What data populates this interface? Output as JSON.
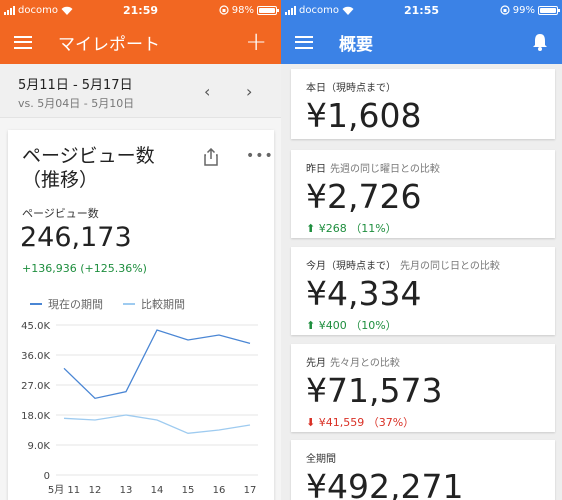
{
  "left": {
    "status": {
      "carrier": "docomo",
      "time": "21:59",
      "battery": "98%",
      "battery_level": 0.98
    },
    "appbar": {
      "title": "マイレポート",
      "add_label": "+"
    },
    "date_range": {
      "range": "5月11日 - 5月17日",
      "compare": "vs. 5月04日 - 5月10日",
      "prev": "‹",
      "next": "›"
    },
    "card": {
      "title": "ページビュー数（推移）",
      "more": "•••",
      "metric_label": "ページビュー数",
      "metric_value": "246,173",
      "metric_delta": "+136,936 (+125.36%)",
      "legend": [
        "現在の期間",
        "比較期間"
      ]
    },
    "chart_data": {
      "type": "line",
      "x": [
        "5月 11",
        "12",
        "13",
        "14",
        "15",
        "16",
        "17"
      ],
      "yticks": [
        "45.0K",
        "36.0K",
        "27.0K",
        "18.0K",
        "9.0K",
        "0"
      ],
      "ylim": [
        0,
        45000
      ],
      "series": [
        {
          "name": "現在の期間",
          "color": "#4a86d4",
          "values": [
            32000,
            23000,
            25000,
            43500,
            40500,
            42000,
            39500
          ]
        },
        {
          "name": "比較期間",
          "color": "#9ecbf0",
          "values": [
            17000,
            16500,
            18000,
            16500,
            12500,
            13500,
            15000
          ]
        }
      ]
    },
    "colors": {
      "accent": "#f26722"
    }
  },
  "right": {
    "status": {
      "carrier": "docomo",
      "time": "21:55",
      "battery": "99%",
      "battery_level": 0.99
    },
    "appbar": {
      "title": "概要"
    },
    "cards": [
      {
        "label": "本日（現時点まで）",
        "sub": "",
        "amount": "¥1,608",
        "change": "",
        "dir": ""
      },
      {
        "label": "昨日",
        "sub": "先週の同じ曜日との比較",
        "amount": "¥2,726",
        "change": "¥268 （11%）",
        "dir": "up"
      },
      {
        "label": "今月（現時点まで）",
        "sub": "先月の同じ日との比較",
        "amount": "¥4,334",
        "change": "¥400 （10%）",
        "dir": "up"
      },
      {
        "label": "先月",
        "sub": "先々月との比較",
        "amount": "¥71,573",
        "change": "¥41,559 （37%）",
        "dir": "down"
      },
      {
        "label": "全期間",
        "sub": "",
        "amount": "¥492,271",
        "change": "",
        "dir": ""
      }
    ],
    "colors": {
      "accent": "#3b82e6",
      "up": "#1e8e3e",
      "down": "#d93025"
    }
  }
}
